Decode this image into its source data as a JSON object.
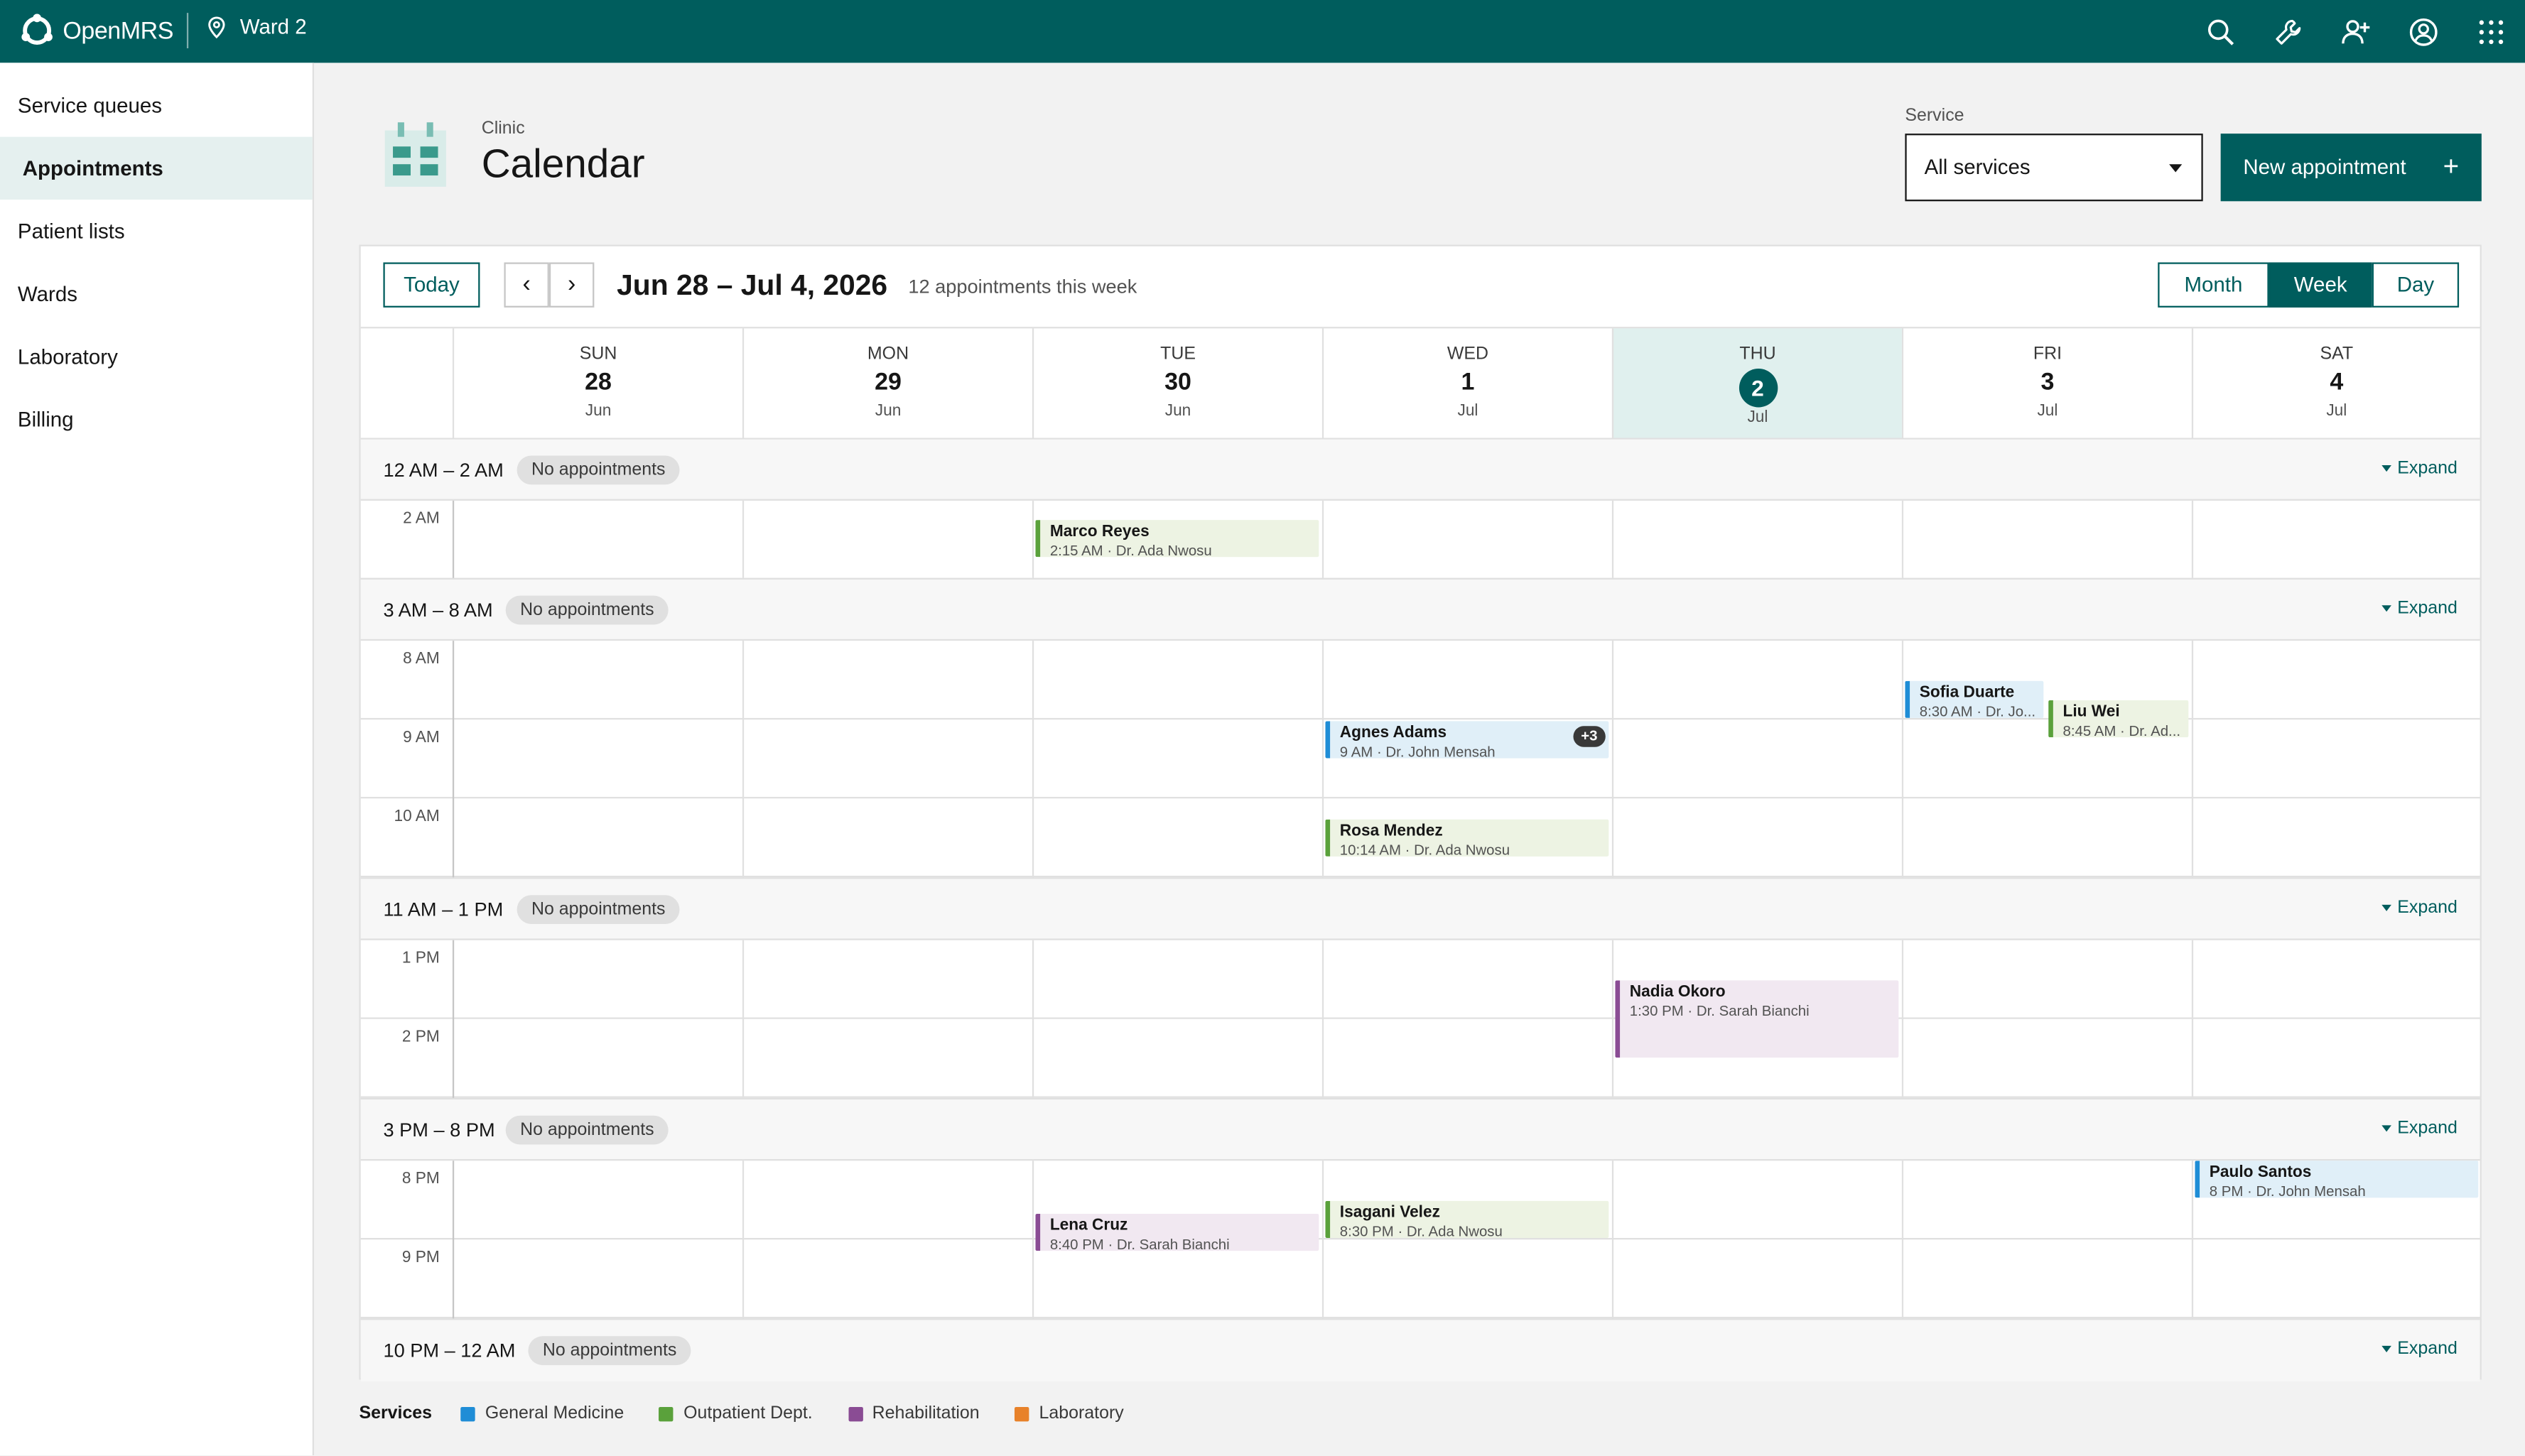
{
  "header": {
    "brand": "OpenMRS",
    "location": "Ward 2",
    "icons": [
      "search-icon",
      "wrench-icon",
      "add-user-icon",
      "user-avatar-icon",
      "app-switcher-icon"
    ]
  },
  "sidebar": {
    "items": [
      {
        "label": "Service queues",
        "active": false
      },
      {
        "label": "Appointments",
        "active": true
      },
      {
        "label": "Patient lists",
        "active": false
      },
      {
        "label": "Wards",
        "active": false
      },
      {
        "label": "Laboratory",
        "active": false
      },
      {
        "label": "Billing",
        "active": false
      }
    ]
  },
  "page": {
    "kicker": "Clinic",
    "title": "Calendar",
    "service_label": "Service",
    "service_value": "All services",
    "new_button": "New appointment",
    "new_button_icon": "+"
  },
  "toolbar": {
    "today": "Today",
    "prev": "‹",
    "next": "›",
    "range": "Jun 28 – Jul 4, 2026",
    "count": "12 appointments this week",
    "views": [
      "Month",
      "Week",
      "Day"
    ],
    "active_view": "Week"
  },
  "days": [
    {
      "dow": "SUN",
      "num": "28",
      "mon": "Jun",
      "today": false
    },
    {
      "dow": "MON",
      "num": "29",
      "mon": "Jun",
      "today": false
    },
    {
      "dow": "TUE",
      "num": "30",
      "mon": "Jun",
      "today": false
    },
    {
      "dow": "WED",
      "num": "1",
      "mon": "Jul",
      "today": false
    },
    {
      "dow": "THU",
      "num": "2",
      "mon": "Jul",
      "today": true
    },
    {
      "dow": "FRI",
      "num": "3",
      "mon": "Jul",
      "today": false
    },
    {
      "dow": "SAT",
      "num": "4",
      "mon": "Jul",
      "today": false
    }
  ],
  "bands": [
    {
      "range": "12 AM – 2 AM",
      "pill": "No appointments",
      "expand": "Expand"
    },
    {
      "range": "3 AM – 8 AM",
      "pill": "No appointments",
      "expand": "Expand"
    },
    {
      "range": "11 AM – 1 PM",
      "pill": "No appointments",
      "expand": "Expand"
    },
    {
      "range": "3 PM – 8 PM",
      "pill": "No appointments",
      "expand": "Expand"
    },
    {
      "range": "10 PM – 12 AM",
      "pill": "No appointments",
      "expand": "Expand"
    }
  ],
  "hour_labels": [
    "2 AM",
    "8 AM",
    "9 AM",
    "10 AM",
    "1 PM",
    "2 PM",
    "8 PM",
    "9 PM"
  ],
  "appointments": [
    {
      "patient": "Marco Reyes",
      "detail": "2:15 AM · Dr. Ada Nwosu",
      "service": "out"
    },
    {
      "patient": "Sofia Duarte",
      "detail": "8:30 AM · Dr. Jo...",
      "service": "gen"
    },
    {
      "patient": "Liu Wei",
      "detail": "8:45 AM · Dr. Ad...",
      "service": "out"
    },
    {
      "patient": "Agnes Adams",
      "detail": "9 AM · Dr. John Mensah",
      "service": "gen",
      "more": "+3"
    },
    {
      "patient": "Rosa Mendez",
      "detail": "10:14 AM · Dr. Ada Nwosu",
      "service": "out"
    },
    {
      "patient": "Nadia Okoro",
      "detail": "1:30 PM · Dr. Sarah Bianchi",
      "service": "reh"
    },
    {
      "patient": "Paulo Santos",
      "detail": "8 PM · Dr. John Mensah",
      "service": "gen"
    },
    {
      "patient": "Isagani Velez",
      "detail": "8:30 PM · Dr. Ada Nwosu",
      "service": "out"
    },
    {
      "patient": "Lena Cruz",
      "detail": "8:40 PM · Dr. Sarah Bianchi",
      "service": "reh"
    }
  ],
  "legend": {
    "title": "Services",
    "items": [
      {
        "label": "General Medicine",
        "color": "#1f8dd6"
      },
      {
        "label": "Outpatient Dept.",
        "color": "#5aa13b"
      },
      {
        "label": "Rehabilitation",
        "color": "#8a4c94"
      },
      {
        "label": "Laboratory",
        "color": "#e8822a"
      }
    ]
  }
}
